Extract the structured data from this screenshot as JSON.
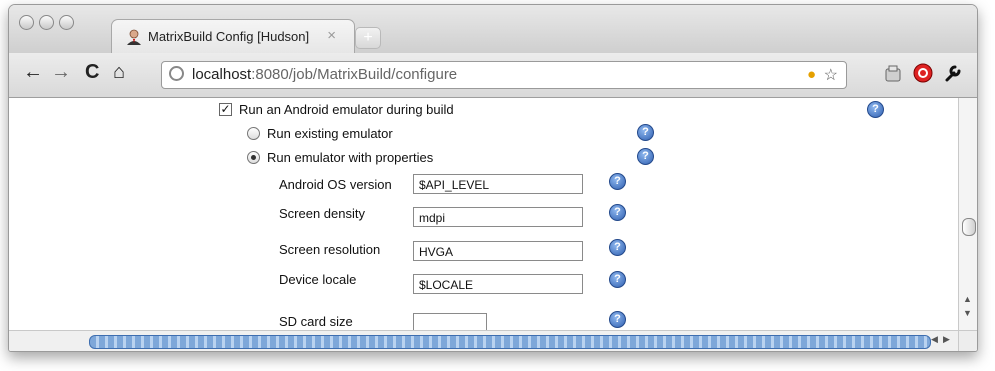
{
  "browser": {
    "tab_title": "MatrixBuild Config [Hudson]",
    "tab_close": "×",
    "new_tab": "+",
    "url_host": "localhost",
    "url_rest": ":8080/job/MatrixBuild/configure",
    "nav": {
      "back": "←",
      "forward": "→",
      "reload": "C",
      "home": "⌂"
    }
  },
  "form": {
    "android_emulator_label": "Run an Android emulator during build",
    "android_emulator_checked": true,
    "options": [
      {
        "label": "Run existing emulator",
        "selected": false
      },
      {
        "label": "Run emulator with properties",
        "selected": true
      }
    ],
    "fields": [
      {
        "label": "Android OS version",
        "value": "$API_LEVEL"
      },
      {
        "label": "Screen density",
        "value": "mdpi"
      },
      {
        "label": "Screen resolution",
        "value": "HVGA"
      },
      {
        "label": "Device locale",
        "value": "$LOCALE"
      },
      {
        "label": "SD card size",
        "value": ""
      }
    ]
  },
  "icons": {
    "help": "help-icon",
    "rss": "rss-feed-icon",
    "bookmark": "star-icon",
    "page_menu": "page-menu-icon",
    "stop": "stop-extension-icon",
    "wrench": "wrench-icon"
  },
  "colors": {
    "help_blue": "#2f5fb0",
    "scroll_blue": "#7ea7d9"
  }
}
